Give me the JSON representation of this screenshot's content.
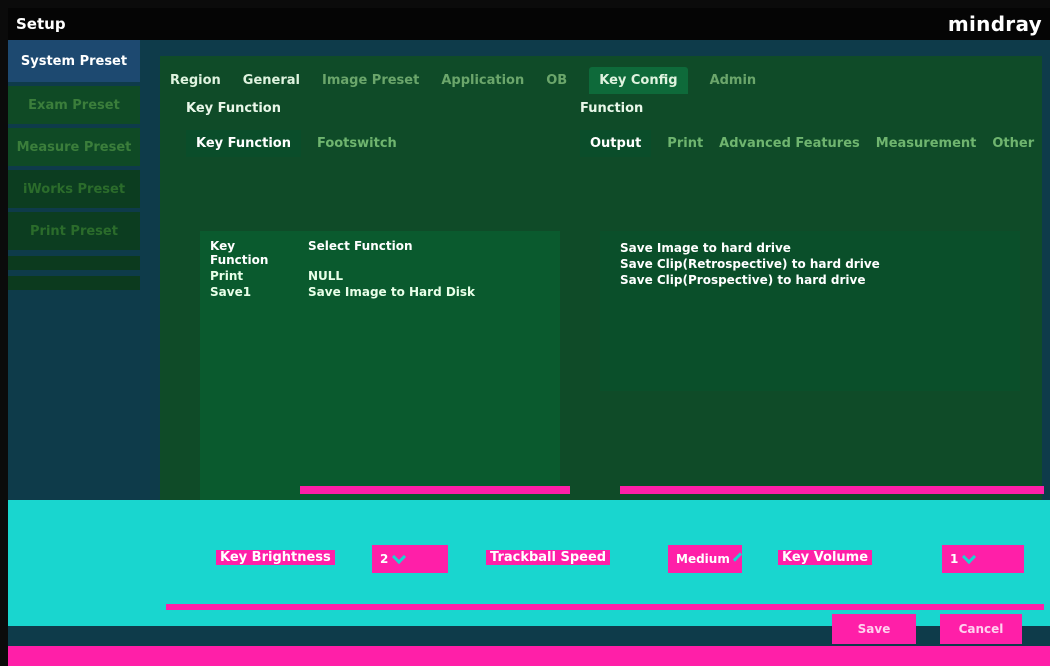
{
  "app": {
    "title": "Setup",
    "brand": "mindray"
  },
  "left_nav": {
    "items": [
      {
        "label": "System Preset",
        "active": true
      },
      {
        "label": "Exam Preset",
        "active": false
      },
      {
        "label": "Measure Preset",
        "active": false
      },
      {
        "label": "iWorks Preset",
        "active": false
      },
      {
        "label": "Print Preset",
        "active": false
      }
    ]
  },
  "top_tabs": [
    {
      "label": "Region",
      "active": false
    },
    {
      "label": "General",
      "active": false
    },
    {
      "label": "Image Preset",
      "active": false
    },
    {
      "label": "Application",
      "active": false
    },
    {
      "label": "OB",
      "active": false
    },
    {
      "label": "Key Config",
      "active": true
    },
    {
      "label": "Admin",
      "active": false
    }
  ],
  "key_function_panel": {
    "section_title": "Key Function",
    "tabs": [
      {
        "label": "Key Function",
        "active": true
      },
      {
        "label": "Footswitch",
        "active": false
      }
    ],
    "table": {
      "headers": [
        "Key Function",
        "Select Function"
      ],
      "rows": [
        [
          "Print",
          "NULL"
        ],
        [
          "Save1",
          "Save Image to Hard Disk"
        ]
      ]
    }
  },
  "function_panel": {
    "section_title": "Function",
    "tabs": [
      {
        "label": "Output",
        "active": true
      },
      {
        "label": "Print",
        "active": false
      },
      {
        "label": "Advanced Features",
        "active": false
      },
      {
        "label": "Measurement",
        "active": false
      },
      {
        "label": "Other",
        "active": false
      }
    ],
    "options": [
      "Save Image to hard drive",
      "Save Clip(Retrospective) to hard drive",
      "Save Clip(Prospective) to hard drive"
    ]
  },
  "bottom_settings": {
    "key_brightness_label": "Key Brightness",
    "key_brightness_value": "2",
    "trackball_speed_label": "Trackball Speed",
    "trackball_speed_value": "Medium",
    "key_volume_label": "Key Volume",
    "key_volume_value": "1"
  },
  "actions": {
    "save": "Save",
    "cancel": "Cancel"
  },
  "colors": {
    "teal": "#19d6cf",
    "magenta": "#ff1fa8",
    "green_panel": "#0f4b28"
  }
}
